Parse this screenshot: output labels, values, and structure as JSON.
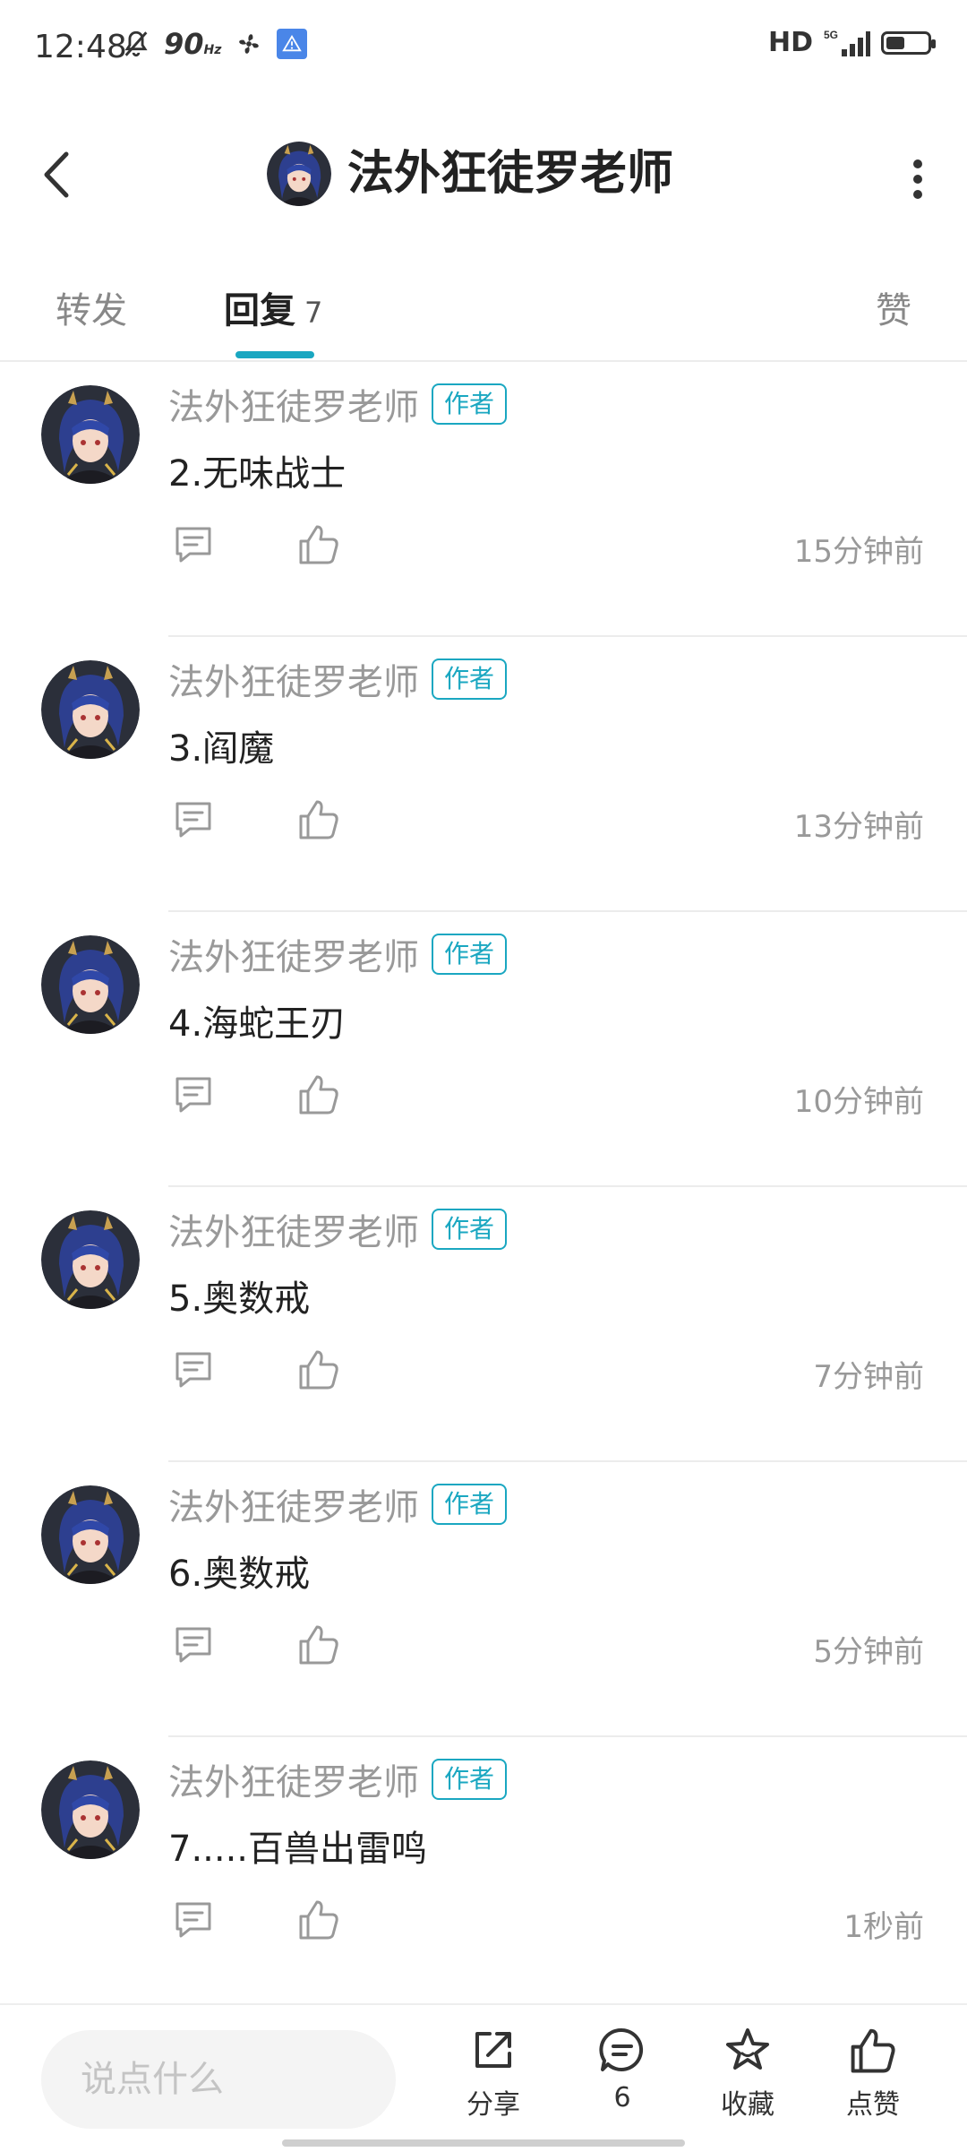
{
  "status_bar": {
    "time": "12:48",
    "refresh_rate": "90",
    "refresh_unit": "Hz",
    "network_hd": "HD",
    "network_gen": "5G",
    "battery_level": 0.45,
    "icons": [
      "mute-bell-icon",
      "fan-icon",
      "alert-icon",
      "signal-icon",
      "battery-icon"
    ]
  },
  "header": {
    "title": "法外狂徒罗老师",
    "avatar": "avatar-icon"
  },
  "tabs": {
    "forward": "转发",
    "reply": "回复",
    "reply_count": "7",
    "like": "赞",
    "active": "reply",
    "accent_color": "#1aa7c1"
  },
  "comments": [
    {
      "name": "法外狂徒罗老师",
      "badge": "作者",
      "text": "2.无味战士",
      "time": "15分钟前"
    },
    {
      "name": "法外狂徒罗老师",
      "badge": "作者",
      "text": "3.阎魔",
      "time": "13分钟前"
    },
    {
      "name": "法外狂徒罗老师",
      "badge": "作者",
      "text": "4.海蛇王刃",
      "time": "10分钟前"
    },
    {
      "name": "法外狂徒罗老师",
      "badge": "作者",
      "text": "5.奥数戒",
      "time": "7分钟前"
    },
    {
      "name": "法外狂徒罗老师",
      "badge": "作者",
      "text": "6.奥数戒",
      "time": "5分钟前"
    },
    {
      "name": "法外狂徒罗老师",
      "badge": "作者",
      "text": "7.....百兽出雷鸣",
      "time": "1秒前"
    }
  ],
  "bottom_bar": {
    "input_placeholder": "说点什么",
    "share_label": "分享",
    "comment_count": "6",
    "favorite_label": "收藏",
    "like_label": "点赞"
  }
}
